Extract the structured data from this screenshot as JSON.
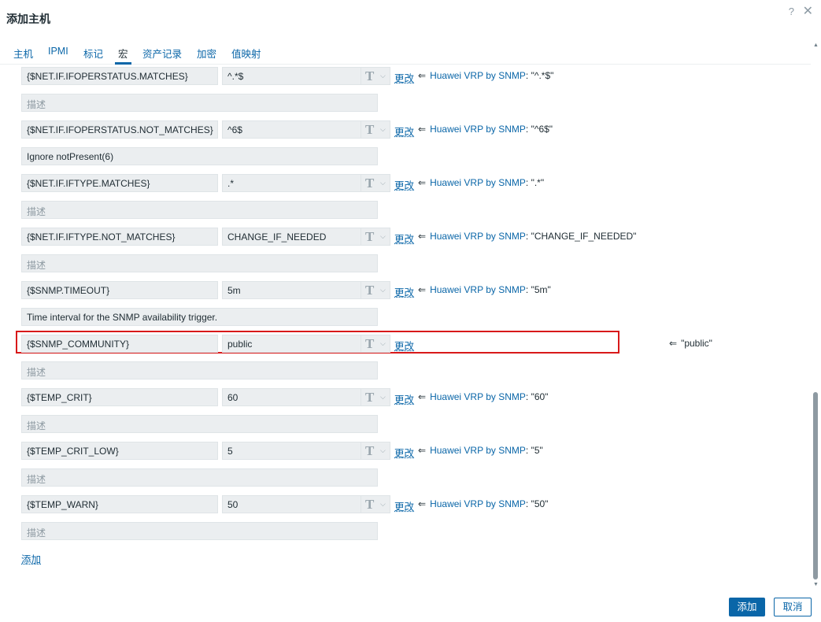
{
  "dialog": {
    "title": "添加主机",
    "help_glyph": "?",
    "close_glyph": "✕"
  },
  "tabs": [
    {
      "label": "主机"
    },
    {
      "label": "IPMI"
    },
    {
      "label": "标记"
    },
    {
      "label": "宏"
    },
    {
      "label": "资产记录"
    },
    {
      "label": "加密"
    },
    {
      "label": "值映射"
    }
  ],
  "active_tab": "宏",
  "type_glyph": "T",
  "chevron_glyph": "⌵",
  "change_label": "更改",
  "inherit_arrow": "⇐",
  "template_name": "Huawei VRP by SNMP",
  "macros": [
    {
      "macro": "{$NET.IF.IFOPERSTATUS.MATCHES}",
      "value": "^.*$",
      "description": "",
      "description_placeholder": "描述",
      "inherited": "\"^.*$\""
    },
    {
      "macro": "{$NET.IF.IFOPERSTATUS.NOT_MATCHES}",
      "value": "^6$",
      "description": "Ignore notPresent(6)",
      "description_placeholder": "描述",
      "inherited": "\"^6$\""
    },
    {
      "macro": "{$NET.IF.IFTYPE.MATCHES}",
      "value": ".*",
      "description": "",
      "description_placeholder": "描述",
      "inherited": "\".*\""
    },
    {
      "macro": "{$NET.IF.IFTYPE.NOT_MATCHES}",
      "value": "CHANGE_IF_NEEDED",
      "description": "",
      "description_placeholder": "描述",
      "inherited": "\"CHANGE_IF_NEEDED\""
    },
    {
      "macro": "{$SNMP.TIMEOUT}",
      "value": "5m",
      "description": "Time interval for the SNMP availability trigger.",
      "description_placeholder": "描述",
      "inherited": "\"5m\""
    },
    {
      "macro": "{$SNMP_COMMUNITY}",
      "value": "public",
      "description": "",
      "description_placeholder": "描述",
      "inherited": "\"public\"",
      "global": true
    },
    {
      "macro": "{$TEMP_CRIT}",
      "value": "60",
      "description": "",
      "description_placeholder": "描述",
      "inherited": "\"60\""
    },
    {
      "macro": "{$TEMP_CRIT_LOW}",
      "value": "5",
      "description": "",
      "description_placeholder": "描述",
      "inherited": "\"5\""
    },
    {
      "macro": "{$TEMP_WARN}",
      "value": "50",
      "description": "",
      "description_placeholder": "描述",
      "inherited": "\"50\""
    }
  ],
  "add_macro_label": "添加",
  "footer": {
    "add_button": "添加",
    "cancel_button": "取消"
  },
  "colors": {
    "accent": "#0a66a8",
    "highlight": "#d8191a",
    "field_bg": "#ebeef0"
  }
}
